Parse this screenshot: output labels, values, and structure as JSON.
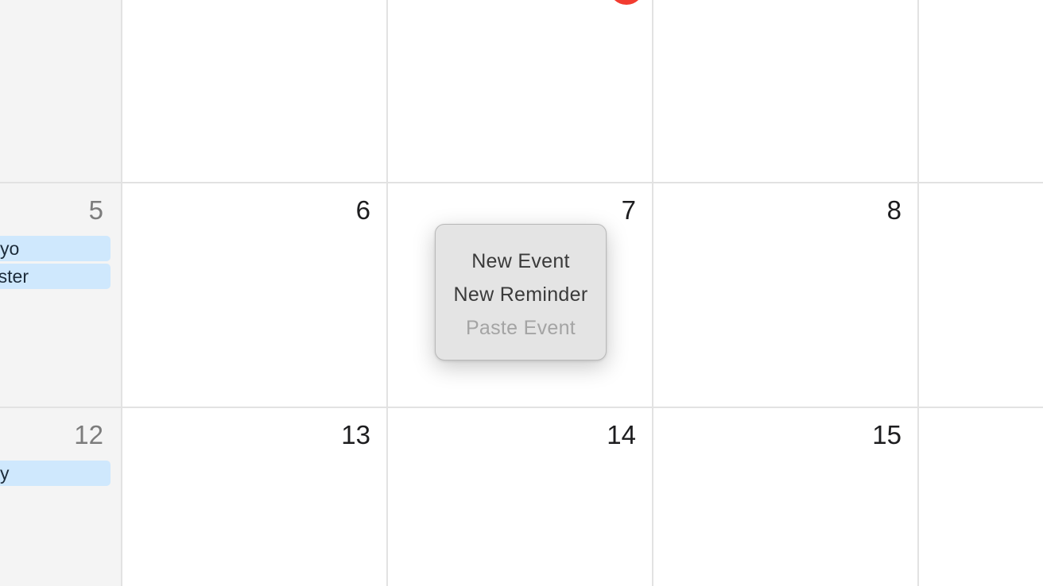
{
  "calendar": {
    "weekend_column_color": "#f4f4f4",
    "today_indicator_color": "#f23b30",
    "event_color": "#cfe8fd",
    "rows": [
      {
        "days": []
      },
      {
        "days": [
          {
            "number": "5",
            "weekend": true,
            "events": [
              "yo",
              "ster"
            ]
          },
          {
            "number": "6"
          },
          {
            "number": "7"
          },
          {
            "number": "8"
          }
        ]
      },
      {
        "days": [
          {
            "number": "12",
            "weekend": true,
            "events": [
              "y"
            ]
          },
          {
            "number": "13"
          },
          {
            "number": "14"
          },
          {
            "number": "15"
          }
        ]
      }
    ]
  },
  "context_menu": {
    "items": [
      {
        "label": "New Event",
        "enabled": true
      },
      {
        "label": "New Reminder",
        "enabled": true
      },
      {
        "label": "Paste Event",
        "enabled": false
      }
    ]
  }
}
